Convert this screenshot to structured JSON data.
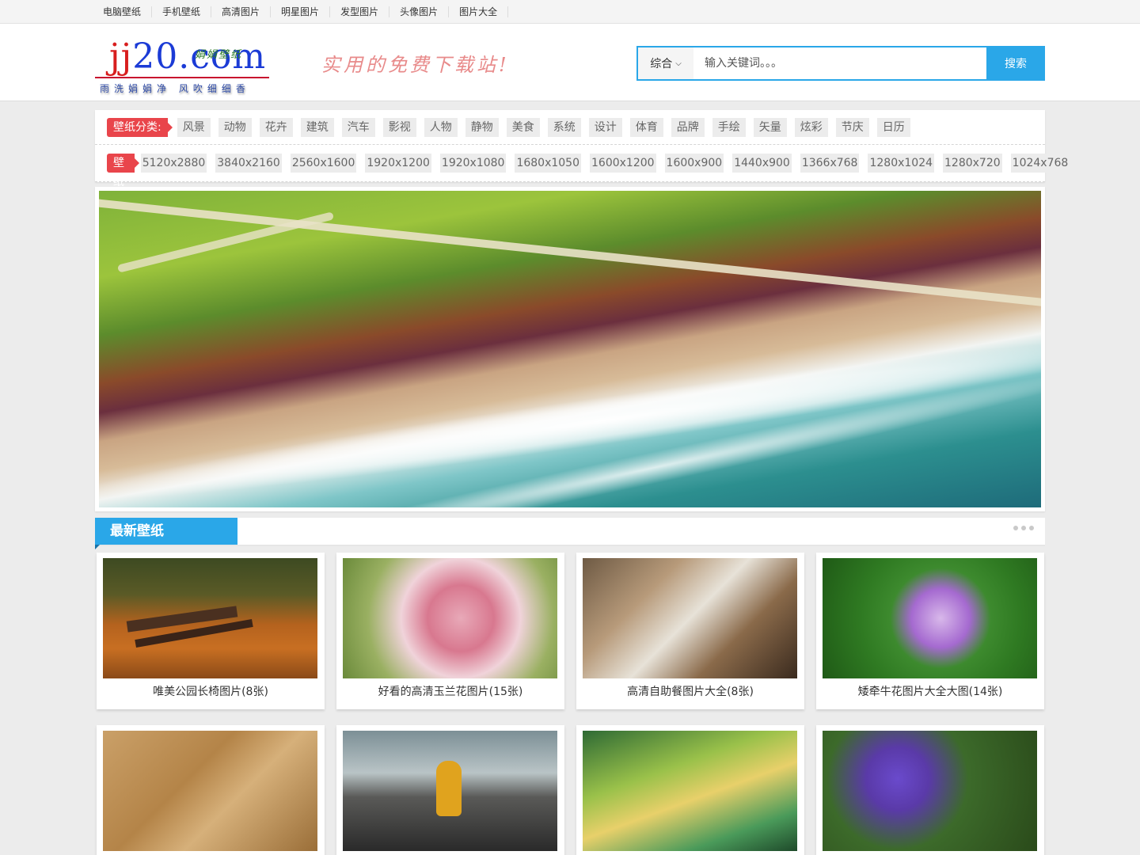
{
  "topnav": {
    "items": [
      "电脑壁纸",
      "手机壁纸",
      "高清图片",
      "明星图片",
      "发型图片",
      "头像图片",
      "图片大全"
    ]
  },
  "logo": {
    "domain_part1": "jj",
    "domain_part2": "20.",
    "domain_part3": "com",
    "subtitle": "娟娟壁纸",
    "motto": "雨洗娟娟净 风吹细细香"
  },
  "slogan": "实用的免费下载站!",
  "search": {
    "select_value": "综合",
    "placeholder": "输入关键词。。。",
    "button_label": "搜索"
  },
  "filter": {
    "category_label": "壁纸分类:",
    "categories": [
      "风景",
      "动物",
      "花卉",
      "建筑",
      "汽车",
      "影视",
      "人物",
      "静物",
      "美食",
      "系统",
      "设计",
      "体育",
      "品牌",
      "手绘",
      "矢量",
      "炫彩",
      "节庆",
      "日历"
    ],
    "size_label": "壁纸尺寸:",
    "sizes": [
      "5120x2880",
      "3840x2160",
      "2560x1600",
      "1920x1200",
      "1920x1080",
      "1680x1050",
      "1600x1200",
      "1600x900",
      "1440x900",
      "1366x768",
      "1280x1024",
      "1280x720",
      "1024x768"
    ]
  },
  "section": {
    "title": "最新壁纸"
  },
  "colors": {
    "accent": "#2aa7e8",
    "tag_red": "#e9454b"
  },
  "gallery": [
    {
      "caption": "唯美公园长椅图片(8张)",
      "thumb": "bench"
    },
    {
      "caption": "好看的高清玉兰花图片(15张)",
      "thumb": "magnolia"
    },
    {
      "caption": "高清自助餐图片大全(8张)",
      "thumb": "buffet"
    },
    {
      "caption": "矮牵牛花图片大全大图(14张)",
      "thumb": "morning"
    },
    {
      "caption": "",
      "thumb": "fossil"
    },
    {
      "caption": "",
      "thumb": "beach"
    },
    {
      "caption": "",
      "thumb": "grass"
    },
    {
      "caption": "",
      "thumb": "violet"
    }
  ]
}
